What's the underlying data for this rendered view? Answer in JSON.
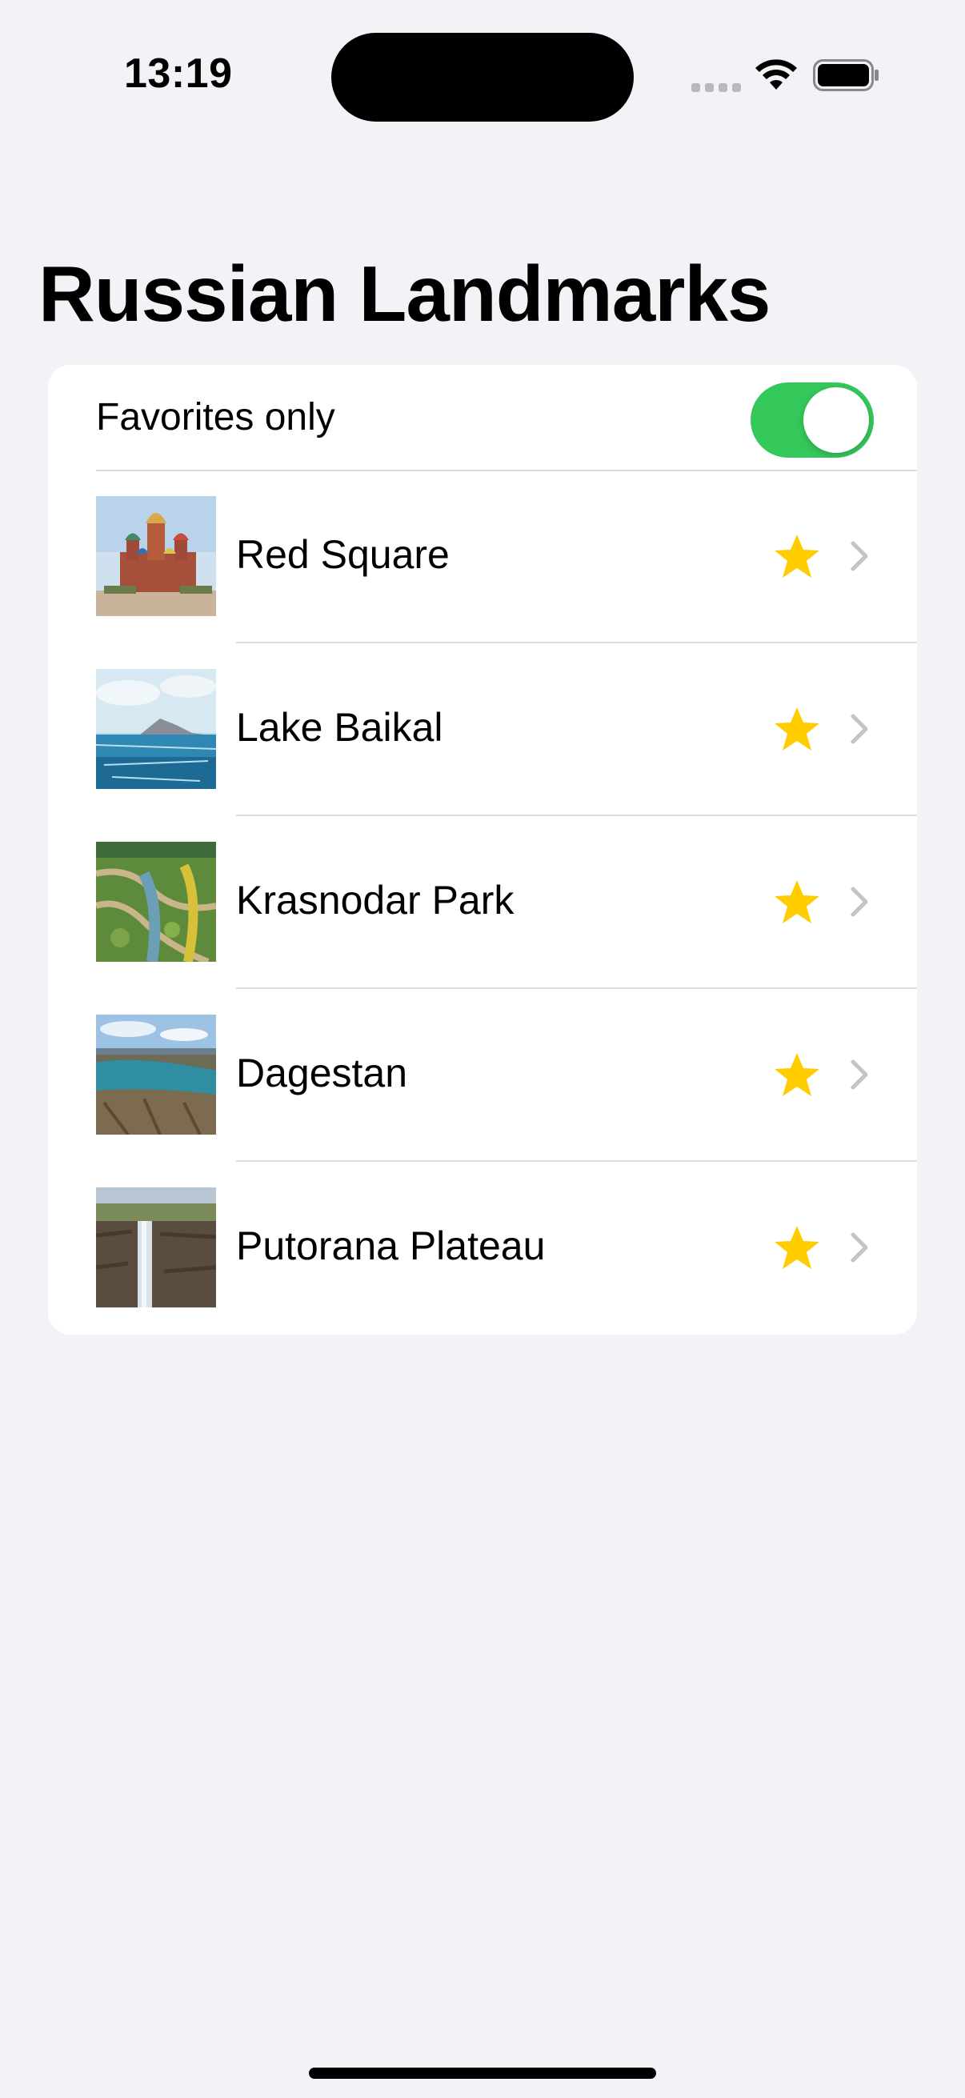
{
  "status_bar": {
    "time": "13:19",
    "icons": [
      "signal-icon",
      "wifi-icon",
      "battery-icon"
    ]
  },
  "title": "Russian Landmarks",
  "favorites_toggle": {
    "label": "Favorites only",
    "on": true,
    "on_color": "#34c759"
  },
  "landmarks": [
    {
      "name": "Red Square",
      "favorite": true,
      "thumbnail": "red-square-image"
    },
    {
      "name": "Lake Baikal",
      "favorite": true,
      "thumbnail": "lake-baikal-image"
    },
    {
      "name": "Krasnodar Park",
      "favorite": true,
      "thumbnail": "krasnodar-park-image"
    },
    {
      "name": "Dagestan",
      "favorite": true,
      "thumbnail": "dagestan-image"
    },
    {
      "name": "Putorana Plateau",
      "favorite": true,
      "thumbnail": "putorana-plateau-image"
    }
  ],
  "colors": {
    "background": "#f2f2f7",
    "card": "#ffffff",
    "star": "#ffcc00",
    "chevron": "#c4c4c7"
  }
}
